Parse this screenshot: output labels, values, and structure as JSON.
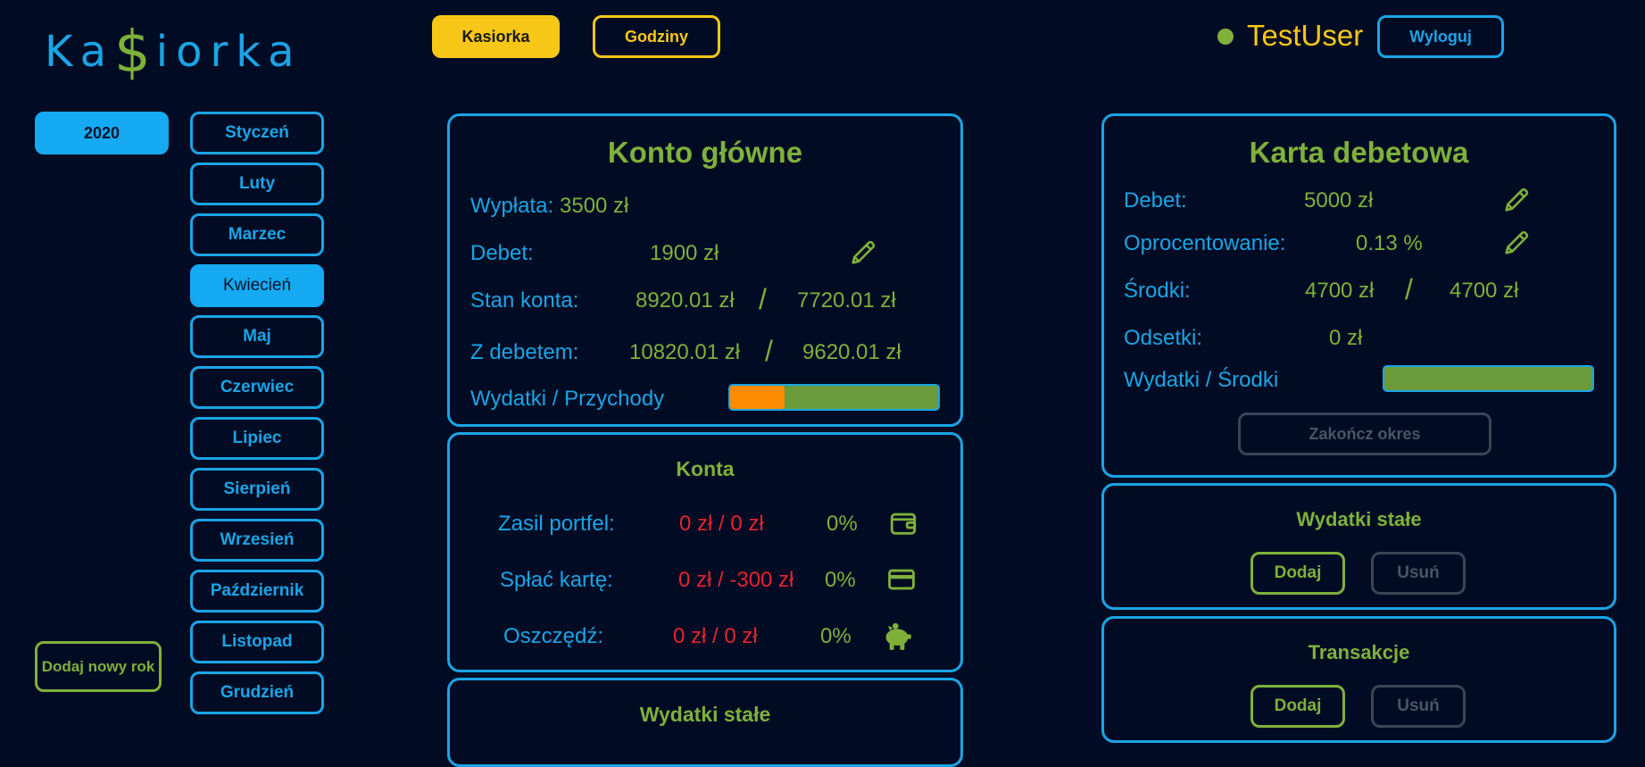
{
  "app": {
    "logo_left": "Ka",
    "logo_symbol": "$",
    "logo_right": "iorka"
  },
  "nav": {
    "tab_kasiorka": "Kasiorka",
    "tab_godziny": "Godziny"
  },
  "user": {
    "name": "TestUser",
    "logout": "Wyloguj",
    "status_color": "#7fb13a"
  },
  "sidebar": {
    "year": "2020",
    "add_year": "Dodaj nowy rok",
    "active_month": "Kwiecień",
    "months": [
      "Styczeń",
      "Luty",
      "Marzec",
      "Kwiecień",
      "Maj",
      "Czerwiec",
      "Lipiec",
      "Sierpień",
      "Wrzesień",
      "Październik",
      "Listopad",
      "Grudzień"
    ]
  },
  "main_account": {
    "title": "Konto główne",
    "salary_label": "Wypłata:",
    "salary_value": "3500 zł",
    "debit_label": "Debet:",
    "debit_value": "1900 zł",
    "balance_label": "Stan konta:",
    "balance_value": "8920.01 zł",
    "balance_value2": "7720.01 zł",
    "with_debit_label": "Z debetem:",
    "with_debit_value": "10820.01 zł",
    "with_debit_value2": "9620.01 zł",
    "slash": "/",
    "ratio_label": "Wydatki / Przychody",
    "ratio_fill_percent": 26
  },
  "accounts": {
    "title": "Konta",
    "rows": [
      {
        "label": "Zasil portfel:",
        "amount": "0 zł / 0 zł",
        "percent": "0%",
        "icon": "wallet-icon"
      },
      {
        "label": "Spłać kartę:",
        "amount": "0 zł / -300 zł",
        "percent": "0%",
        "icon": "credit-card-icon"
      },
      {
        "label": "Oszczędź:",
        "amount": "0 zł / 0 zł",
        "percent": "0%",
        "icon": "piggy-bank-icon"
      }
    ]
  },
  "fixed_expenses_main": {
    "title": "Wydatki stałe"
  },
  "debit_card": {
    "title": "Karta debetowa",
    "debit_label": "Debet:",
    "debit_value": "5000 zł",
    "interest_label": "Oprocentowanie:",
    "interest_value": "0.13 %",
    "funds_label": "Środki:",
    "funds_value": "4700 zł",
    "funds_value2": "4700 zł",
    "slash": "/",
    "accrued_label": "Odsetki:",
    "accrued_value": "0 zł",
    "ratio_label": "Wydatki / Środki",
    "ratio_fill_percent": 0,
    "close_period": "Zakończ okres"
  },
  "fixed_expenses": {
    "title": "Wydatki stałe",
    "add": "Dodaj",
    "remove": "Usuń"
  },
  "transactions": {
    "title": "Transakcje",
    "add": "Dodaj",
    "remove": "Usuń"
  }
}
